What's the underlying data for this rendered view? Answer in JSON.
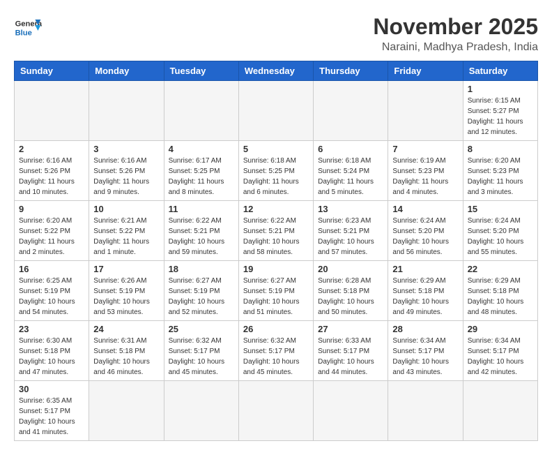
{
  "header": {
    "logo_general": "General",
    "logo_blue": "Blue",
    "month_year": "November 2025",
    "location": "Naraini, Madhya Pradesh, India"
  },
  "weekdays": [
    "Sunday",
    "Monday",
    "Tuesday",
    "Wednesday",
    "Thursday",
    "Friday",
    "Saturday"
  ],
  "days": [
    {
      "date": "",
      "sunrise": "",
      "sunset": "",
      "daylight": ""
    },
    {
      "date": "",
      "sunrise": "",
      "sunset": "",
      "daylight": ""
    },
    {
      "date": "",
      "sunrise": "",
      "sunset": "",
      "daylight": ""
    },
    {
      "date": "",
      "sunrise": "",
      "sunset": "",
      "daylight": ""
    },
    {
      "date": "",
      "sunrise": "",
      "sunset": "",
      "daylight": ""
    },
    {
      "date": "",
      "sunrise": "",
      "sunset": "",
      "daylight": ""
    },
    {
      "date": "1",
      "sunrise": "Sunrise: 6:15 AM",
      "sunset": "Sunset: 5:27 PM",
      "daylight": "Daylight: 11 hours and 12 minutes."
    },
    {
      "date": "2",
      "sunrise": "Sunrise: 6:16 AM",
      "sunset": "Sunset: 5:26 PM",
      "daylight": "Daylight: 11 hours and 10 minutes."
    },
    {
      "date": "3",
      "sunrise": "Sunrise: 6:16 AM",
      "sunset": "Sunset: 5:26 PM",
      "daylight": "Daylight: 11 hours and 9 minutes."
    },
    {
      "date": "4",
      "sunrise": "Sunrise: 6:17 AM",
      "sunset": "Sunset: 5:25 PM",
      "daylight": "Daylight: 11 hours and 8 minutes."
    },
    {
      "date": "5",
      "sunrise": "Sunrise: 6:18 AM",
      "sunset": "Sunset: 5:25 PM",
      "daylight": "Daylight: 11 hours and 6 minutes."
    },
    {
      "date": "6",
      "sunrise": "Sunrise: 6:18 AM",
      "sunset": "Sunset: 5:24 PM",
      "daylight": "Daylight: 11 hours and 5 minutes."
    },
    {
      "date": "7",
      "sunrise": "Sunrise: 6:19 AM",
      "sunset": "Sunset: 5:23 PM",
      "daylight": "Daylight: 11 hours and 4 minutes."
    },
    {
      "date": "8",
      "sunrise": "Sunrise: 6:20 AM",
      "sunset": "Sunset: 5:23 PM",
      "daylight": "Daylight: 11 hours and 3 minutes."
    },
    {
      "date": "9",
      "sunrise": "Sunrise: 6:20 AM",
      "sunset": "Sunset: 5:22 PM",
      "daylight": "Daylight: 11 hours and 2 minutes."
    },
    {
      "date": "10",
      "sunrise": "Sunrise: 6:21 AM",
      "sunset": "Sunset: 5:22 PM",
      "daylight": "Daylight: 11 hours and 1 minute."
    },
    {
      "date": "11",
      "sunrise": "Sunrise: 6:22 AM",
      "sunset": "Sunset: 5:21 PM",
      "daylight": "Daylight: 10 hours and 59 minutes."
    },
    {
      "date": "12",
      "sunrise": "Sunrise: 6:22 AM",
      "sunset": "Sunset: 5:21 PM",
      "daylight": "Daylight: 10 hours and 58 minutes."
    },
    {
      "date": "13",
      "sunrise": "Sunrise: 6:23 AM",
      "sunset": "Sunset: 5:21 PM",
      "daylight": "Daylight: 10 hours and 57 minutes."
    },
    {
      "date": "14",
      "sunrise": "Sunrise: 6:24 AM",
      "sunset": "Sunset: 5:20 PM",
      "daylight": "Daylight: 10 hours and 56 minutes."
    },
    {
      "date": "15",
      "sunrise": "Sunrise: 6:24 AM",
      "sunset": "Sunset: 5:20 PM",
      "daylight": "Daylight: 10 hours and 55 minutes."
    },
    {
      "date": "16",
      "sunrise": "Sunrise: 6:25 AM",
      "sunset": "Sunset: 5:19 PM",
      "daylight": "Daylight: 10 hours and 54 minutes."
    },
    {
      "date": "17",
      "sunrise": "Sunrise: 6:26 AM",
      "sunset": "Sunset: 5:19 PM",
      "daylight": "Daylight: 10 hours and 53 minutes."
    },
    {
      "date": "18",
      "sunrise": "Sunrise: 6:27 AM",
      "sunset": "Sunset: 5:19 PM",
      "daylight": "Daylight: 10 hours and 52 minutes."
    },
    {
      "date": "19",
      "sunrise": "Sunrise: 6:27 AM",
      "sunset": "Sunset: 5:19 PM",
      "daylight": "Daylight: 10 hours and 51 minutes."
    },
    {
      "date": "20",
      "sunrise": "Sunrise: 6:28 AM",
      "sunset": "Sunset: 5:18 PM",
      "daylight": "Daylight: 10 hours and 50 minutes."
    },
    {
      "date": "21",
      "sunrise": "Sunrise: 6:29 AM",
      "sunset": "Sunset: 5:18 PM",
      "daylight": "Daylight: 10 hours and 49 minutes."
    },
    {
      "date": "22",
      "sunrise": "Sunrise: 6:29 AM",
      "sunset": "Sunset: 5:18 PM",
      "daylight": "Daylight: 10 hours and 48 minutes."
    },
    {
      "date": "23",
      "sunrise": "Sunrise: 6:30 AM",
      "sunset": "Sunset: 5:18 PM",
      "daylight": "Daylight: 10 hours and 47 minutes."
    },
    {
      "date": "24",
      "sunrise": "Sunrise: 6:31 AM",
      "sunset": "Sunset: 5:18 PM",
      "daylight": "Daylight: 10 hours and 46 minutes."
    },
    {
      "date": "25",
      "sunrise": "Sunrise: 6:32 AM",
      "sunset": "Sunset: 5:17 PM",
      "daylight": "Daylight: 10 hours and 45 minutes."
    },
    {
      "date": "26",
      "sunrise": "Sunrise: 6:32 AM",
      "sunset": "Sunset: 5:17 PM",
      "daylight": "Daylight: 10 hours and 45 minutes."
    },
    {
      "date": "27",
      "sunrise": "Sunrise: 6:33 AM",
      "sunset": "Sunset: 5:17 PM",
      "daylight": "Daylight: 10 hours and 44 minutes."
    },
    {
      "date": "28",
      "sunrise": "Sunrise: 6:34 AM",
      "sunset": "Sunset: 5:17 PM",
      "daylight": "Daylight: 10 hours and 43 minutes."
    },
    {
      "date": "29",
      "sunrise": "Sunrise: 6:34 AM",
      "sunset": "Sunset: 5:17 PM",
      "daylight": "Daylight: 10 hours and 42 minutes."
    },
    {
      "date": "30",
      "sunrise": "Sunrise: 6:35 AM",
      "sunset": "Sunset: 5:17 PM",
      "daylight": "Daylight: 10 hours and 41 minutes."
    }
  ]
}
